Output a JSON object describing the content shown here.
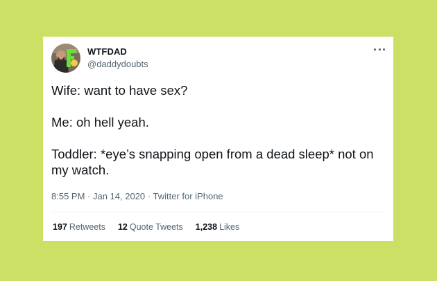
{
  "background_color": "#cbe065",
  "tweet": {
    "author": {
      "display_name": "WTFDAD",
      "handle": "@daddydoubts",
      "avatar_icon": "avatar-photo"
    },
    "more_icon": "more-options-icon",
    "lines": [
      "Wife: want to have sex?",
      "Me: oh hell yeah.",
      "Toddler: *eye’s snapping open from a dead sleep* not on my watch."
    ],
    "meta": {
      "time": "8:55 PM",
      "separator": " · ",
      "date": "Jan 14, 2020",
      "source": "Twitter for iPhone"
    },
    "stats": {
      "retweets_count": "197",
      "retweets_label": "Retweets",
      "quotes_count": "12",
      "quotes_label": "Quote Tweets",
      "likes_count": "1,238",
      "likes_label": "Likes"
    }
  },
  "colors": {
    "text_primary": "#0f1419",
    "text_secondary": "#536471",
    "card_bg": "#ffffff"
  }
}
